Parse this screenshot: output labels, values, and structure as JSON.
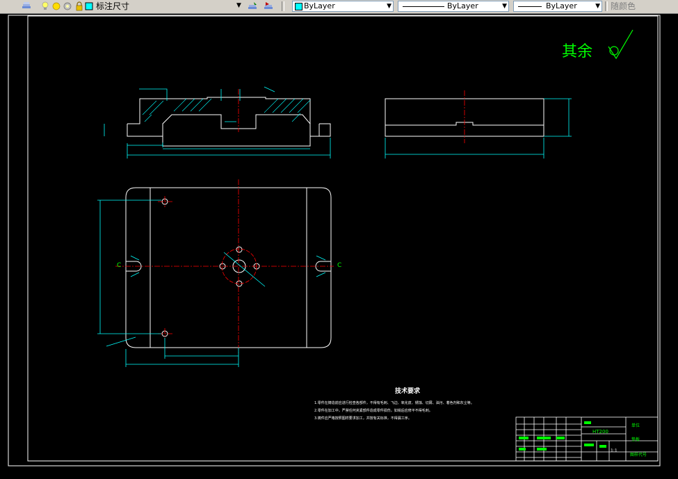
{
  "toolbar": {
    "dimstyle": "标注尺寸",
    "layer_color": "ByLayer",
    "linetype": "ByLayer",
    "lineweight": "ByLayer",
    "plotstyle": "随颜色"
  },
  "drawing": {
    "surface_note": "其余",
    "title": "技术要求",
    "requirements": [
      "1.零件在铸造前应进行检查各部件，不得有毛刺、飞边、氧化皮、锈蚀、切屑、油污、着色剂和灰尘等。",
      "2.零件在加工中，严禁任何夹紧部件造成零件损伤，如铣后应修平不得毛刺。",
      "3.铸件应严格按照图样要求加工，并按有关标准，不得漏工序。"
    ],
    "title_block": {
      "material": "HT200",
      "unit": "单位",
      "name": "垫板",
      "drawing_no": "图样代号",
      "scale": "1:1"
    },
    "section_labels": {
      "left": "C",
      "right": "C"
    }
  }
}
